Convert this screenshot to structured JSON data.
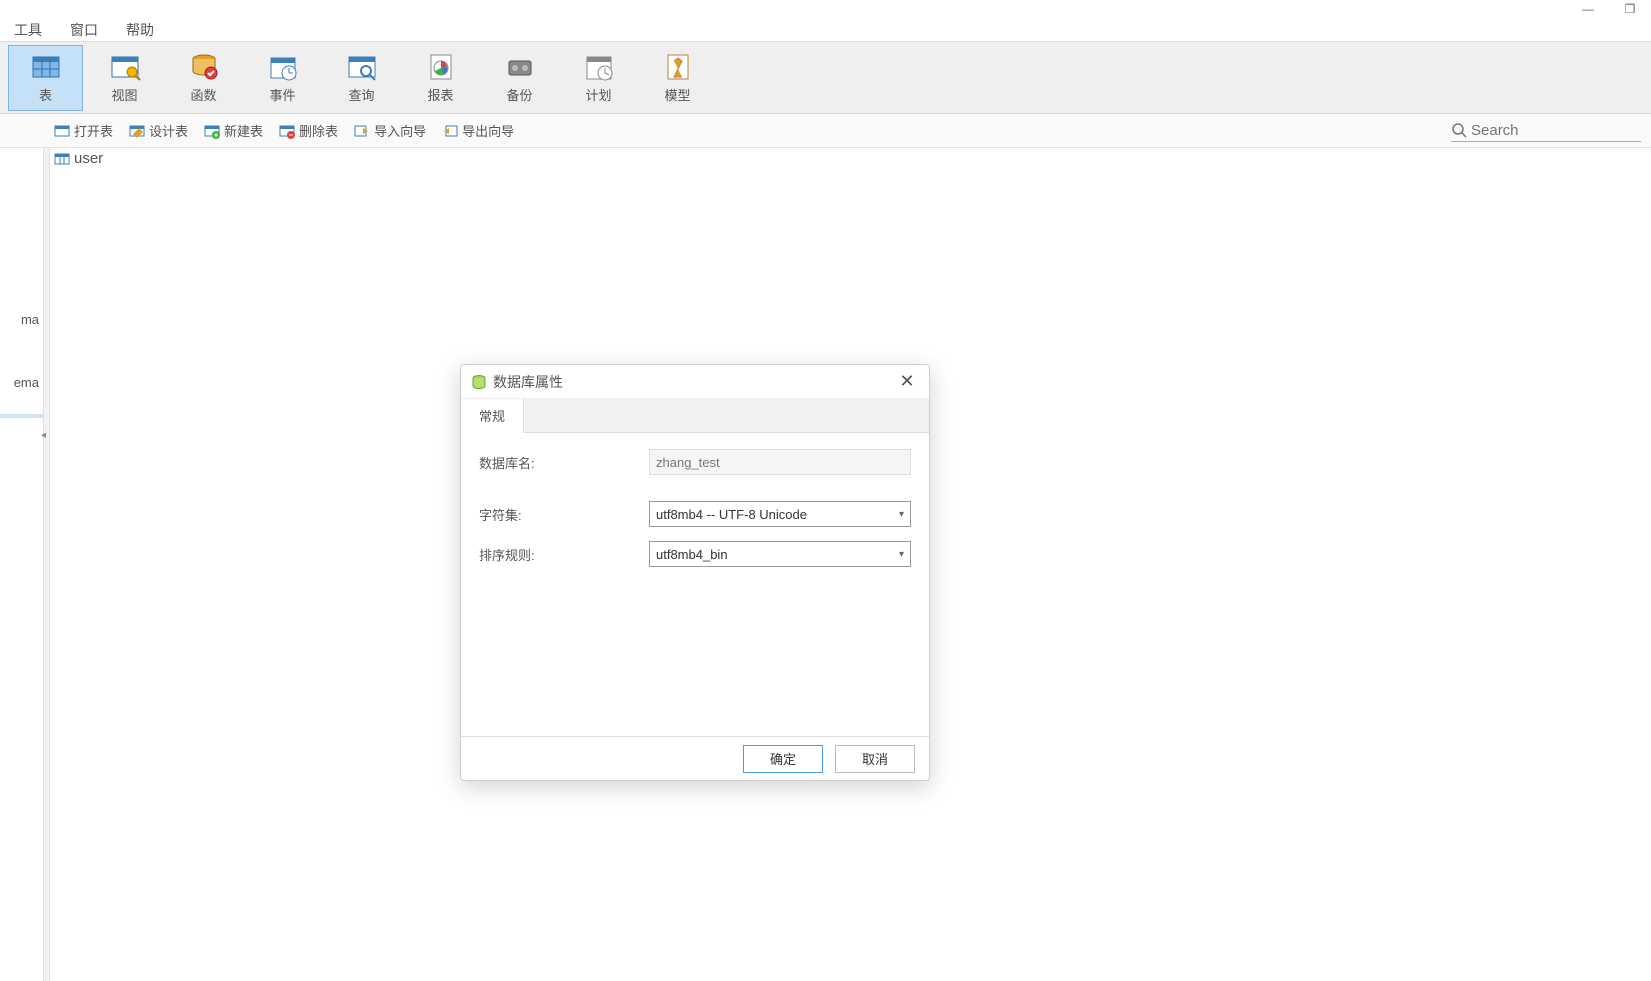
{
  "window": {
    "minimize": "—",
    "maximize": "❐",
    "close": "✕"
  },
  "menu": {
    "tools": "工具",
    "window": "窗口",
    "help": "帮助"
  },
  "toolbar": [
    {
      "label": "表"
    },
    {
      "label": "视图"
    },
    {
      "label": "函数"
    },
    {
      "label": "事件"
    },
    {
      "label": "查询"
    },
    {
      "label": "报表"
    },
    {
      "label": "备份"
    },
    {
      "label": "计划"
    },
    {
      "label": "模型"
    }
  ],
  "subtoolbar": {
    "open_table": "打开表",
    "design_table": "设计表",
    "new_table": "新建表",
    "delete_table": "删除表",
    "import_wizard": "导入向导",
    "export_wizard": "导出向导"
  },
  "search": {
    "placeholder": "Search"
  },
  "tree": {
    "item1": "ma",
    "item2": "ema",
    "item3": ""
  },
  "content": {
    "user_item": "user"
  },
  "dialog": {
    "title": "数据库属性",
    "tab_general": "常规",
    "label_dbname": "数据库名:",
    "value_dbname": "zhang_test",
    "label_charset": "字符集:",
    "value_charset": "utf8mb4 -- UTF-8 Unicode",
    "label_collation": "排序规则:",
    "value_collation": "utf8mb4_bin",
    "btn_ok": "确定",
    "btn_cancel": "取消"
  }
}
